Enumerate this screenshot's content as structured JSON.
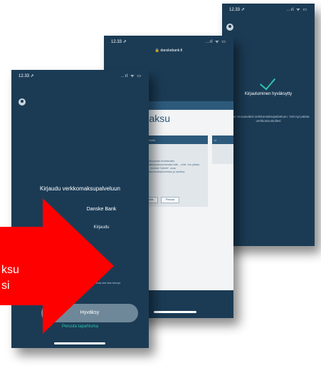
{
  "colors": {
    "phone_bg": "#1b3b55",
    "accent": "#2ec4a9",
    "arrow": "#ff0000",
    "web_bg": "#f2f4f6"
  },
  "phone3": {
    "time": "12.33 ⇗",
    "signal": "..ıl ᯤ ▭",
    "success_title": "Kirjautuminen hyväksytty",
    "success_text": "Jatkat seuraavaksi verkkomaksupalveluun. Voit nyt palata verkkosivustollesi"
  },
  "phone2": {
    "time": "12.33 ⇗",
    "signal": "..ıl ᯤ ▭",
    "url": "🔒 danskebank.fi",
    "heading": "omaksu",
    "card_title": "rkkopankkiin",
    "card_text": "uodu verkkopankin tiinattamalla siukulukuttaöyhtamannämalla lutiä..., mille. Jos pitaisa hyn... yo.. tumlesi.\"Lähetti\", avaa ijaarnastakuntuulohjelmeessa ja hyväksy",
    "btn_left": "Lähetä",
    "btn_right": "Peruuta",
    "side_title": "Li"
  },
  "phone1": {
    "time": "12.33 ⇗",
    "signal": "..ıl ᯤ ▭",
    "title": "Kirjaudu verkkomaksupalveluun",
    "bank": "Danske Bank",
    "login_label": "Kirjaudu",
    "note": "...pilaa – hyväksy vain ne ...mat olet itse tehnyt",
    "accept_label": "Hyväksy",
    "cancel_label": "Peruuta tapahtuma"
  },
  "overlay": {
    "line1": "ksu",
    "line2": "si"
  }
}
